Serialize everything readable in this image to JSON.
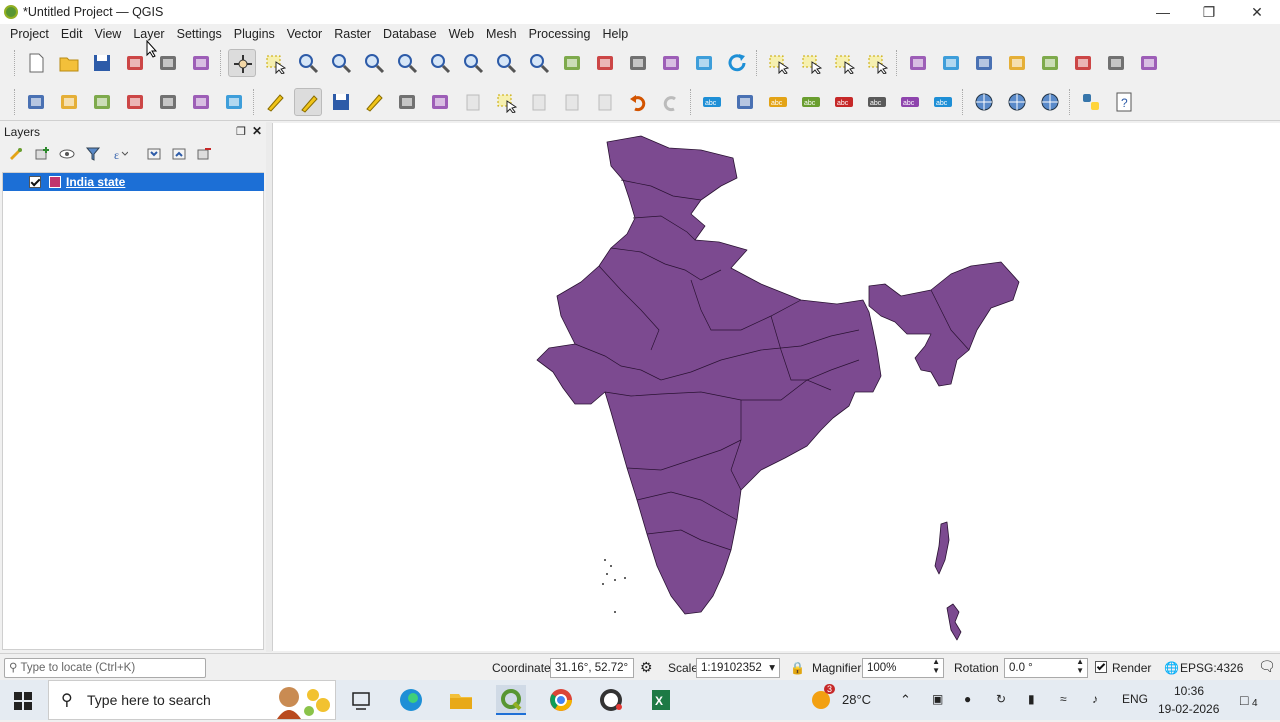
{
  "window": {
    "title": "*Untitled Project — QGIS"
  },
  "menu": [
    "Project",
    "Edit",
    "View",
    "Layer",
    "Settings",
    "Plugins",
    "Vector",
    "Raster",
    "Database",
    "Web",
    "Mesh",
    "Processing",
    "Help"
  ],
  "layers_panel": {
    "title": "Layers",
    "layer_name": "India state",
    "layer_checked": true
  },
  "status": {
    "locator_placeholder": "Type to locate (Ctrl+K)",
    "coordinate_label": "Coordinate",
    "coordinate_value": "31.16°, 52.72°",
    "scale_label": "Scale",
    "scale_value": "1:19102352",
    "magnifier_label": "Magnifier",
    "magnifier_value": "100%",
    "rotation_label": "Rotation",
    "rotation_value": "0.0 °",
    "render_label": "Render",
    "crs": "EPSG:4326"
  },
  "taskbar": {
    "search_placeholder": "Type here to search",
    "weather_temp": "28°C",
    "weather_badge": "3",
    "language": "ENG",
    "time": "10:36",
    "date": "19-02-2026",
    "notif_count": "4"
  },
  "colors": {
    "map_fill": "#7c4a90",
    "selection": "#1c6fd6"
  },
  "icons_tb1": [
    "new-project-icon",
    "open-project-icon",
    "save-project-icon",
    "new-print-layout-icon",
    "layout-manager-icon",
    "style-manager-icon",
    "pan-icon",
    "pan-to-selection-icon",
    "zoom-in-icon",
    "zoom-out-icon",
    "zoom-full-icon",
    "zoom-to-selection-icon",
    "zoom-to-layer-icon",
    "zoom-native-icon",
    "zoom-last-icon",
    "zoom-next-icon",
    "new-map-view-icon",
    "new-3d-view-icon",
    "new-bookmark-icon",
    "show-bookmarks-icon",
    "temporal-controller-icon",
    "refresh-icon",
    "select-features-icon",
    "select-by-value-icon",
    "deselect-icon",
    "select-by-location-icon",
    "identify-icon",
    "field-calculator-icon",
    "toolbox-icon",
    "statistics-icon",
    "attribute-table-icon",
    "measure-icon",
    "map-tips-icon",
    "plugin-tool-icon"
  ],
  "icons_tb2": [
    "data-source-manager-icon",
    "new-geopackage-icon",
    "new-shapefile-icon",
    "new-spatialite-icon",
    "new-temp-layer-icon",
    "new-mesh-icon",
    "new-virtual-layer-icon",
    "digitize-icon",
    "toggle-editing-icon",
    "save-edits-icon",
    "digitize-segment-icon",
    "add-polygon-icon",
    "vertex-tool-icon",
    "modify-attributes-icon",
    "delete-selected-icon",
    "cut-icon",
    "copy-icon",
    "paste-icon",
    "undo-icon",
    "redo-icon",
    "label-icon",
    "diagram-icon",
    "highlight-label-icon",
    "pin-label-icon",
    "show-hide-label-icon",
    "move-label-icon",
    "rotate-label-icon",
    "change-label-icon",
    "metasearch-icon",
    "wms-icon",
    "osm-icon",
    "python-icon",
    "help-icon"
  ]
}
